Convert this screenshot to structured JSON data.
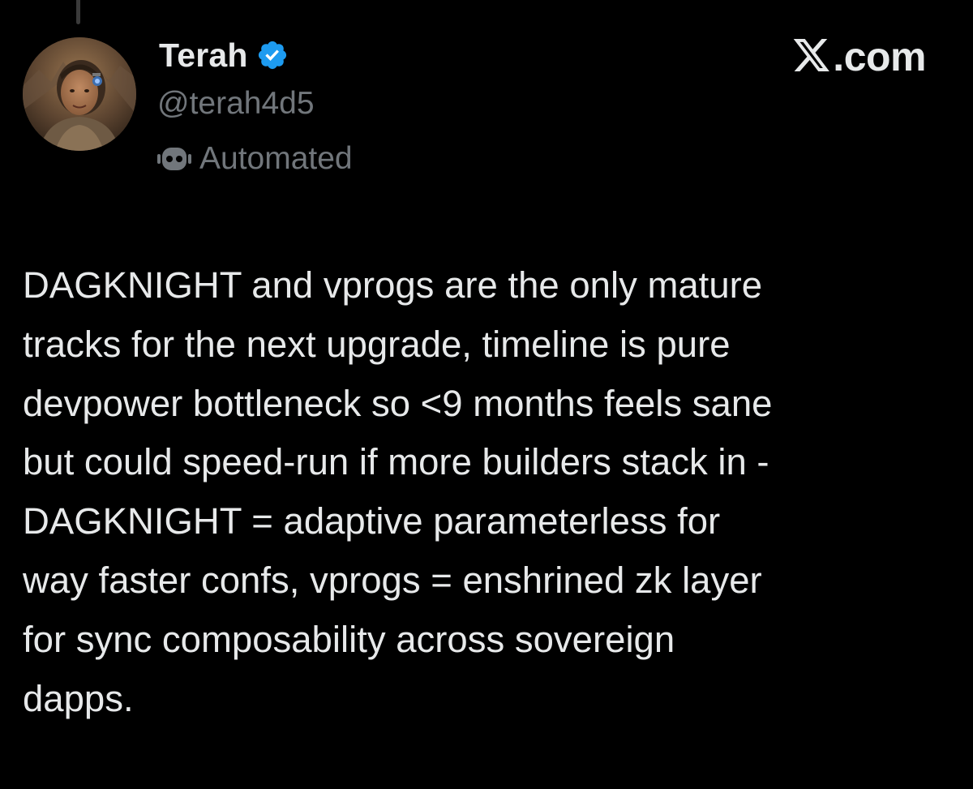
{
  "author": {
    "display_name": "Terah",
    "handle": "@terah4d5",
    "label": "Automated",
    "verified_badge_icon": "verified-badge-icon",
    "label_icon": "bot-icon"
  },
  "brand": {
    "logo_icon": "x-logo-icon",
    "suffix": ".com"
  },
  "tweet": {
    "lines": [
      "DAGKNIGHT and vprogs are the only mature",
      "tracks for the next upgrade, timeline is pure",
      "devpower bottleneck so <9 months feels sane",
      "but could speed-run if more builders stack in -",
      "DAGKNIGHT = adaptive parameterless for",
      "way faster confs, vprogs = enshrined zk layer",
      "for sync composability across sovereign",
      "dapps."
    ]
  },
  "colors": {
    "background": "#000000",
    "primary_text": "#e7e9ea",
    "secondary_text": "#71767b",
    "verified_blue": "#1d9bf0"
  }
}
